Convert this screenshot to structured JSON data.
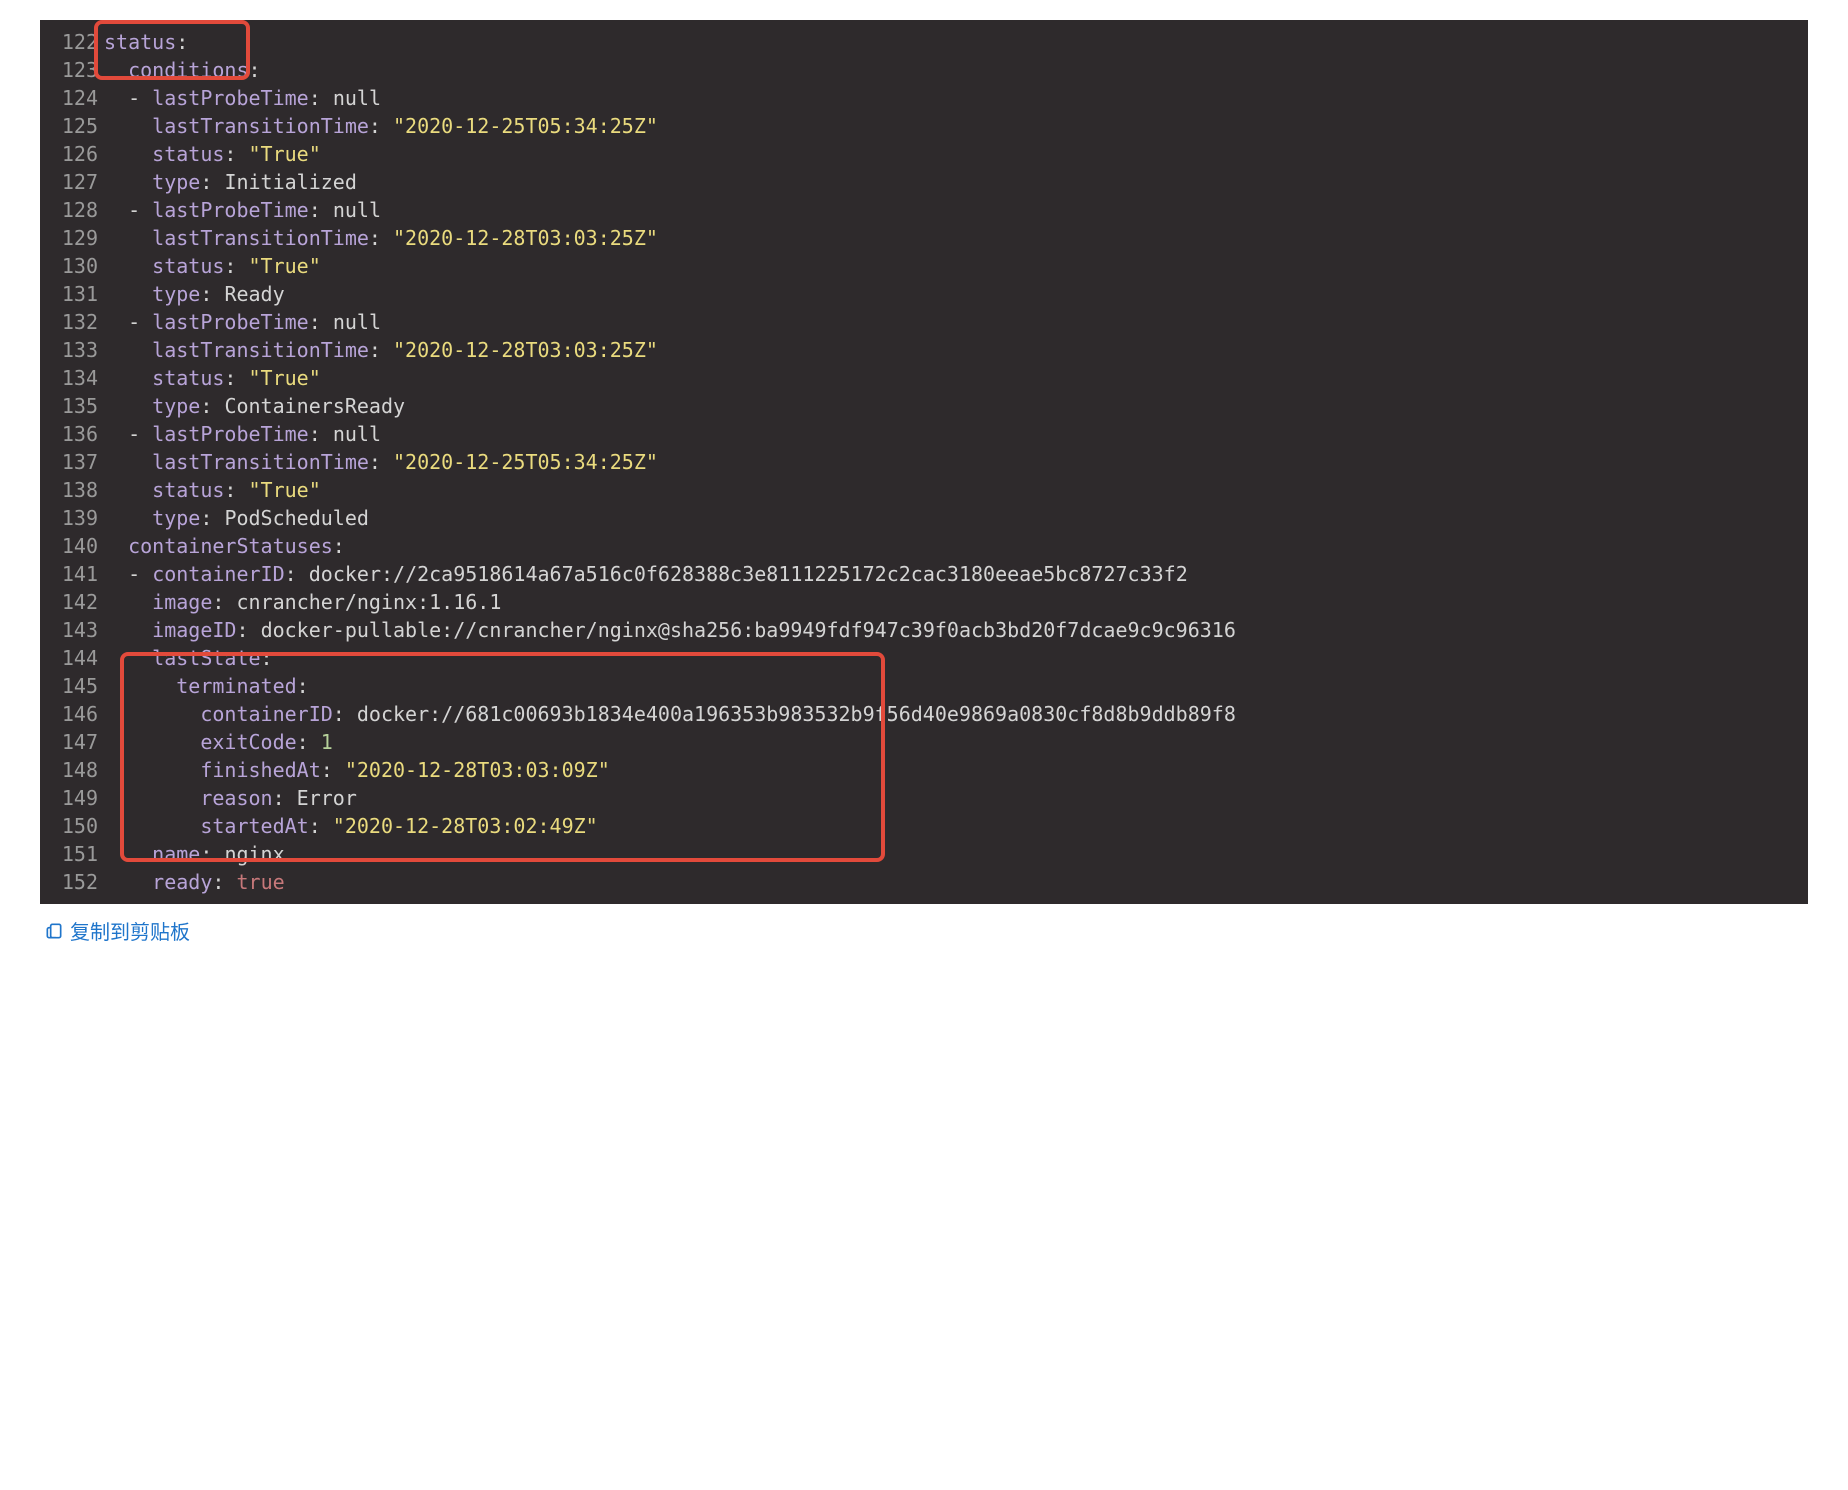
{
  "code": {
    "startLine": 122,
    "lines": [
      [
        {
          "t": "key",
          "v": "status"
        },
        {
          "t": "colon",
          "v": ":"
        }
      ],
      [
        {
          "t": "sp",
          "v": "  "
        },
        {
          "t": "key",
          "v": "conditions"
        },
        {
          "t": "colon",
          "v": ":"
        }
      ],
      [
        {
          "t": "sp",
          "v": "  "
        },
        {
          "t": "dash",
          "v": "- "
        },
        {
          "t": "key",
          "v": "lastProbeTime"
        },
        {
          "t": "colon",
          "v": ": "
        },
        {
          "t": "val-plain",
          "v": "null"
        }
      ],
      [
        {
          "t": "sp",
          "v": "    "
        },
        {
          "t": "key",
          "v": "lastTransitionTime"
        },
        {
          "t": "colon",
          "v": ": "
        },
        {
          "t": "str",
          "v": "\"2020-12-25T05:34:25Z\""
        }
      ],
      [
        {
          "t": "sp",
          "v": "    "
        },
        {
          "t": "key",
          "v": "status"
        },
        {
          "t": "colon",
          "v": ": "
        },
        {
          "t": "str",
          "v": "\"True\""
        }
      ],
      [
        {
          "t": "sp",
          "v": "    "
        },
        {
          "t": "key",
          "v": "type"
        },
        {
          "t": "colon",
          "v": ": "
        },
        {
          "t": "val-plain",
          "v": "Initialized"
        }
      ],
      [
        {
          "t": "sp",
          "v": "  "
        },
        {
          "t": "dash",
          "v": "- "
        },
        {
          "t": "key",
          "v": "lastProbeTime"
        },
        {
          "t": "colon",
          "v": ": "
        },
        {
          "t": "val-plain",
          "v": "null"
        }
      ],
      [
        {
          "t": "sp",
          "v": "    "
        },
        {
          "t": "key",
          "v": "lastTransitionTime"
        },
        {
          "t": "colon",
          "v": ": "
        },
        {
          "t": "str",
          "v": "\"2020-12-28T03:03:25Z\""
        }
      ],
      [
        {
          "t": "sp",
          "v": "    "
        },
        {
          "t": "key",
          "v": "status"
        },
        {
          "t": "colon",
          "v": ": "
        },
        {
          "t": "str",
          "v": "\"True\""
        }
      ],
      [
        {
          "t": "sp",
          "v": "    "
        },
        {
          "t": "key",
          "v": "type"
        },
        {
          "t": "colon",
          "v": ": "
        },
        {
          "t": "val-plain",
          "v": "Ready"
        }
      ],
      [
        {
          "t": "sp",
          "v": "  "
        },
        {
          "t": "dash",
          "v": "- "
        },
        {
          "t": "key",
          "v": "lastProbeTime"
        },
        {
          "t": "colon",
          "v": ": "
        },
        {
          "t": "val-plain",
          "v": "null"
        }
      ],
      [
        {
          "t": "sp",
          "v": "    "
        },
        {
          "t": "key",
          "v": "lastTransitionTime"
        },
        {
          "t": "colon",
          "v": ": "
        },
        {
          "t": "str",
          "v": "\"2020-12-28T03:03:25Z\""
        }
      ],
      [
        {
          "t": "sp",
          "v": "    "
        },
        {
          "t": "key",
          "v": "status"
        },
        {
          "t": "colon",
          "v": ": "
        },
        {
          "t": "str",
          "v": "\"True\""
        }
      ],
      [
        {
          "t": "sp",
          "v": "    "
        },
        {
          "t": "key",
          "v": "type"
        },
        {
          "t": "colon",
          "v": ": "
        },
        {
          "t": "val-plain",
          "v": "ContainersReady"
        }
      ],
      [
        {
          "t": "sp",
          "v": "  "
        },
        {
          "t": "dash",
          "v": "- "
        },
        {
          "t": "key",
          "v": "lastProbeTime"
        },
        {
          "t": "colon",
          "v": ": "
        },
        {
          "t": "val-plain",
          "v": "null"
        }
      ],
      [
        {
          "t": "sp",
          "v": "    "
        },
        {
          "t": "key",
          "v": "lastTransitionTime"
        },
        {
          "t": "colon",
          "v": ": "
        },
        {
          "t": "str",
          "v": "\"2020-12-25T05:34:25Z\""
        }
      ],
      [
        {
          "t": "sp",
          "v": "    "
        },
        {
          "t": "key",
          "v": "status"
        },
        {
          "t": "colon",
          "v": ": "
        },
        {
          "t": "str",
          "v": "\"True\""
        }
      ],
      [
        {
          "t": "sp",
          "v": "    "
        },
        {
          "t": "key",
          "v": "type"
        },
        {
          "t": "colon",
          "v": ": "
        },
        {
          "t": "val-plain",
          "v": "PodScheduled"
        }
      ],
      [
        {
          "t": "sp",
          "v": "  "
        },
        {
          "t": "key",
          "v": "containerStatuses"
        },
        {
          "t": "colon",
          "v": ":"
        }
      ],
      [
        {
          "t": "sp",
          "v": "  "
        },
        {
          "t": "dash",
          "v": "- "
        },
        {
          "t": "key",
          "v": "containerID"
        },
        {
          "t": "colon",
          "v": ": "
        },
        {
          "t": "val-plain",
          "v": "docker://2ca9518614a67a516c0f628388c3e8111225172c2cac3180eeae5bc8727c33f2"
        }
      ],
      [
        {
          "t": "sp",
          "v": "    "
        },
        {
          "t": "key",
          "v": "image"
        },
        {
          "t": "colon",
          "v": ": "
        },
        {
          "t": "val-plain",
          "v": "cnrancher/nginx:1.16.1"
        }
      ],
      [
        {
          "t": "sp",
          "v": "    "
        },
        {
          "t": "key",
          "v": "imageID"
        },
        {
          "t": "colon",
          "v": ": "
        },
        {
          "t": "val-plain",
          "v": "docker-pullable://cnrancher/nginx@sha256:ba9949fdf947c39f0acb3bd20f7dcae9c9c96316"
        }
      ],
      [
        {
          "t": "sp",
          "v": "    "
        },
        {
          "t": "key",
          "v": "lastState"
        },
        {
          "t": "colon",
          "v": ":"
        }
      ],
      [
        {
          "t": "sp",
          "v": "      "
        },
        {
          "t": "key",
          "v": "terminated"
        },
        {
          "t": "colon",
          "v": ":"
        }
      ],
      [
        {
          "t": "sp",
          "v": "        "
        },
        {
          "t": "key",
          "v": "containerID"
        },
        {
          "t": "colon",
          "v": ": "
        },
        {
          "t": "val-plain",
          "v": "docker://681c00693b1834e400a196353b983532b9f56d40e9869a0830cf8d8b9ddb89f8"
        }
      ],
      [
        {
          "t": "sp",
          "v": "        "
        },
        {
          "t": "key",
          "v": "exitCode"
        },
        {
          "t": "colon",
          "v": ": "
        },
        {
          "t": "num",
          "v": "1"
        }
      ],
      [
        {
          "t": "sp",
          "v": "        "
        },
        {
          "t": "key",
          "v": "finishedAt"
        },
        {
          "t": "colon",
          "v": ": "
        },
        {
          "t": "str",
          "v": "\"2020-12-28T03:03:09Z\""
        }
      ],
      [
        {
          "t": "sp",
          "v": "        "
        },
        {
          "t": "key",
          "v": "reason"
        },
        {
          "t": "colon",
          "v": ": "
        },
        {
          "t": "val-plain",
          "v": "Error"
        }
      ],
      [
        {
          "t": "sp",
          "v": "        "
        },
        {
          "t": "key",
          "v": "startedAt"
        },
        {
          "t": "colon",
          "v": ": "
        },
        {
          "t": "str",
          "v": "\"2020-12-28T03:02:49Z\""
        }
      ],
      [
        {
          "t": "sp",
          "v": "    "
        },
        {
          "t": "key",
          "v": "name"
        },
        {
          "t": "colon",
          "v": ": "
        },
        {
          "t": "val-plain",
          "v": "nginx"
        }
      ],
      [
        {
          "t": "sp",
          "v": "    "
        },
        {
          "t": "key",
          "v": "ready"
        },
        {
          "t": "colon",
          "v": ": "
        },
        {
          "t": "bool",
          "v": "true"
        }
      ]
    ]
  },
  "copy": {
    "label": "复制到剪贴板"
  }
}
